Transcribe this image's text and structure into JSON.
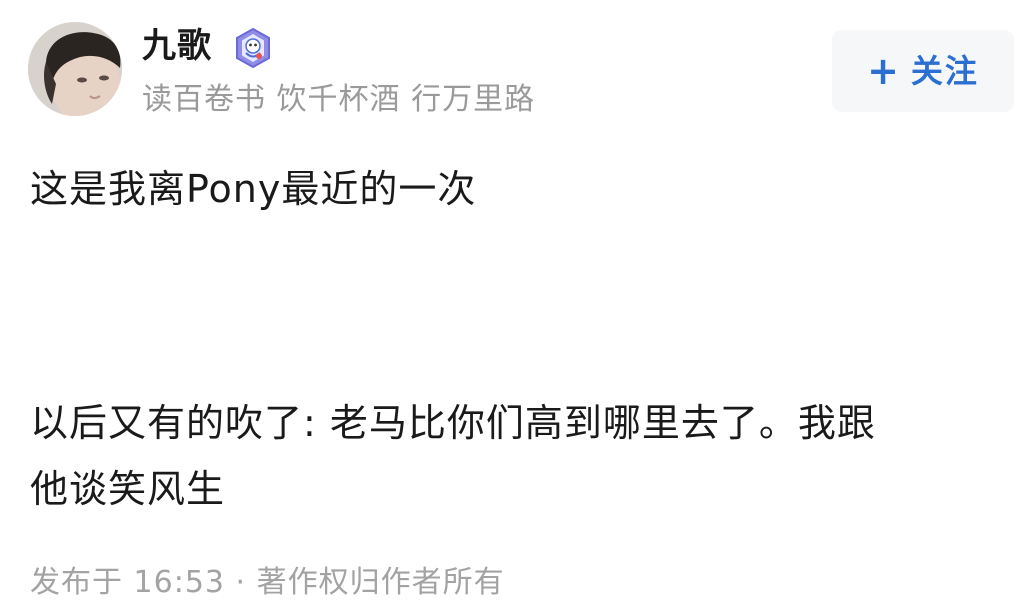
{
  "author": {
    "name": "九歌",
    "bio": "读百卷书 饮千杯酒 行万里路",
    "avatar_icon": "user-photo-avatar",
    "badge_icon": "verified-badge-icon"
  },
  "follow_button": {
    "icon": "plus-icon",
    "plus_glyph": "+",
    "label": "关注"
  },
  "post": {
    "paragraphs": [
      "这是我离Pony最近的一次",
      "以后又有的吹了: 老马比你们高到哪里去了。我跟\n他谈笑风生"
    ],
    "meta": "发布于 16:53 · 著作权归作者所有"
  },
  "colors": {
    "accent": "#2a6fd1",
    "text_primary": "#1a1a1a",
    "text_secondary": "#9a9a9a",
    "button_bg": "#f6f7f9"
  }
}
